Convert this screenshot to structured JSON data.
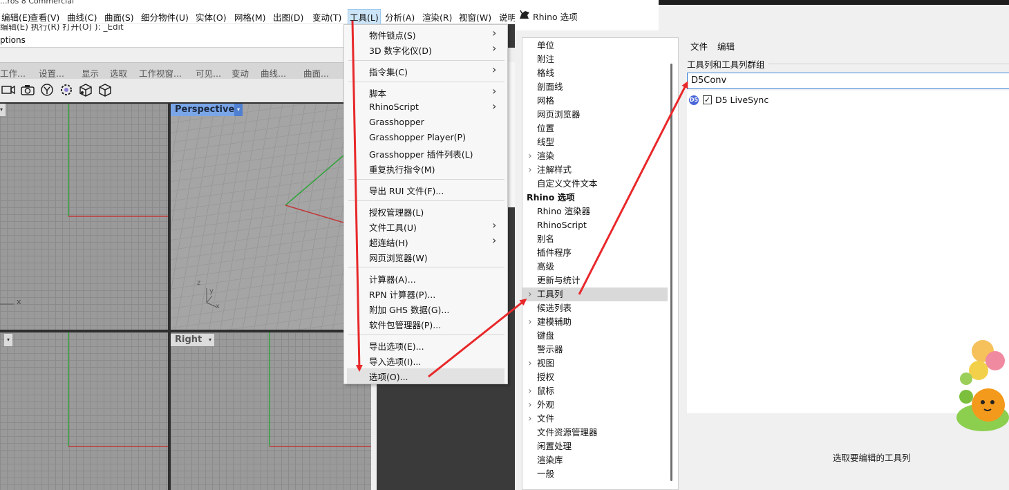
{
  "window": {
    "title_fragment": "...ros 8 Commercial"
  },
  "menubar": {
    "items": [
      "编辑(E)",
      "查看(V)",
      "曲线(C)",
      "曲面(S)",
      "细分物件(U)",
      "实体(O)",
      "网格(M)",
      "出图(D)",
      "变动(T)",
      "工具(L)",
      "分析(A)",
      "渲染(R)",
      "视窗(W)",
      "说明"
    ],
    "active": "工具(L)"
  },
  "command": {
    "history": "编辑(E) 执行(R) 打开(O) ): _Edit",
    "prompt": "ptions"
  },
  "toolbar_tabs": [
    "工作...",
    "设置...",
    "显示",
    "选取",
    "工作视窗...",
    "可见...",
    "变动",
    "曲线...",
    "曲面..."
  ],
  "toolbar_icons": [
    "camera-front-icon",
    "camera-icon",
    "camera-target-icon",
    "gear-camera-icon",
    "cube-view-icon",
    "cube-outline-icon"
  ],
  "viewports": {
    "perspective_label": "Perspective",
    "right_label": "Right",
    "axis_x": "x",
    "axis_y": "y",
    "axis_z": "z"
  },
  "tools_menu": {
    "items": [
      {
        "label": "物件锁点(S)",
        "submenu": true
      },
      {
        "label": "3D 数字化仪(D)",
        "submenu": true
      },
      {
        "label": "指令集(C)",
        "submenu": true
      },
      {
        "label": "脚本",
        "submenu": true
      },
      {
        "label": "RhinoScript",
        "submenu": true
      },
      {
        "label": "Grasshopper",
        "submenu": false
      },
      {
        "label": "Grasshopper Player(P)",
        "submenu": false
      },
      {
        "label": "Grasshopper 插件列表(L)",
        "submenu": false
      },
      {
        "label": "重复执行指令(M)",
        "submenu": false
      },
      {
        "label": "导出 RUI 文件(F)...",
        "submenu": false
      },
      {
        "label": "授权管理器(L)",
        "submenu": false
      },
      {
        "label": "文件工具(U)",
        "submenu": true
      },
      {
        "label": "超连结(H)",
        "submenu": true
      },
      {
        "label": "网页浏览器(W)",
        "submenu": false
      },
      {
        "label": "计算器(A)...",
        "submenu": false
      },
      {
        "label": "RPN 计算器(P)...",
        "submenu": false
      },
      {
        "label": "附加 GHS 数据(G)...",
        "submenu": false
      },
      {
        "label": "软件包管理器(P)...",
        "submenu": false
      },
      {
        "label": "导出选项(E)...",
        "submenu": false
      },
      {
        "label": "导入选项(I)...",
        "submenu": false
      },
      {
        "label": "选项(O)...",
        "submenu": false
      }
    ],
    "highlighted": "选项(O)..."
  },
  "options_dialog": {
    "title": "Rhino 选项",
    "tree": [
      {
        "label": "单位",
        "expand": false
      },
      {
        "label": "附注",
        "expand": false
      },
      {
        "label": "格线",
        "expand": false
      },
      {
        "label": "剖面线",
        "expand": false
      },
      {
        "label": "网格",
        "expand": false
      },
      {
        "label": "网页浏览器",
        "expand": false
      },
      {
        "label": "位置",
        "expand": false
      },
      {
        "label": "线型",
        "expand": false
      },
      {
        "label": "渲染",
        "expand": true
      },
      {
        "label": "注解样式",
        "expand": true
      },
      {
        "label": "自定义文件文本",
        "expand": false
      },
      {
        "label": "Rhino 选项",
        "expand": false,
        "header": true
      },
      {
        "label": "Rhino 渲染器",
        "expand": false
      },
      {
        "label": "RhinoScript",
        "expand": false
      },
      {
        "label": "别名",
        "expand": false
      },
      {
        "label": "插件程序",
        "expand": false
      },
      {
        "label": "高级",
        "expand": false
      },
      {
        "label": "更新与统计",
        "expand": false
      },
      {
        "label": "工具列",
        "expand": true,
        "selected": true
      },
      {
        "label": "候选列表",
        "expand": false
      },
      {
        "label": "建模辅助",
        "expand": true
      },
      {
        "label": "键盘",
        "expand": false
      },
      {
        "label": "警示器",
        "expand": false
      },
      {
        "label": "视图",
        "expand": true
      },
      {
        "label": "授权",
        "expand": false
      },
      {
        "label": "鼠标",
        "expand": true
      },
      {
        "label": "外观",
        "expand": true
      },
      {
        "label": "文件",
        "expand": true
      },
      {
        "label": "文件资源管理器",
        "expand": false
      },
      {
        "label": "闲置处理",
        "expand": false
      },
      {
        "label": "渲染库",
        "expand": false
      },
      {
        "label": "一般",
        "expand": false
      }
    ],
    "right_menu": [
      "文件",
      "编辑"
    ],
    "group_label": "工具列和工具列群组",
    "search_value": "D5Conv",
    "list_item": {
      "label": "D5 LiveSync",
      "checked": true,
      "icon": "d5-logo-icon",
      "icon_text": "D5"
    },
    "hint": "选取要编辑的工具列"
  },
  "colors": {
    "accent": "#3d84d6",
    "arrow": "#e8282a",
    "active_viewport": "#7aa6e8",
    "axis_red": "#c0393b",
    "axis_green": "#2fa33a"
  }
}
